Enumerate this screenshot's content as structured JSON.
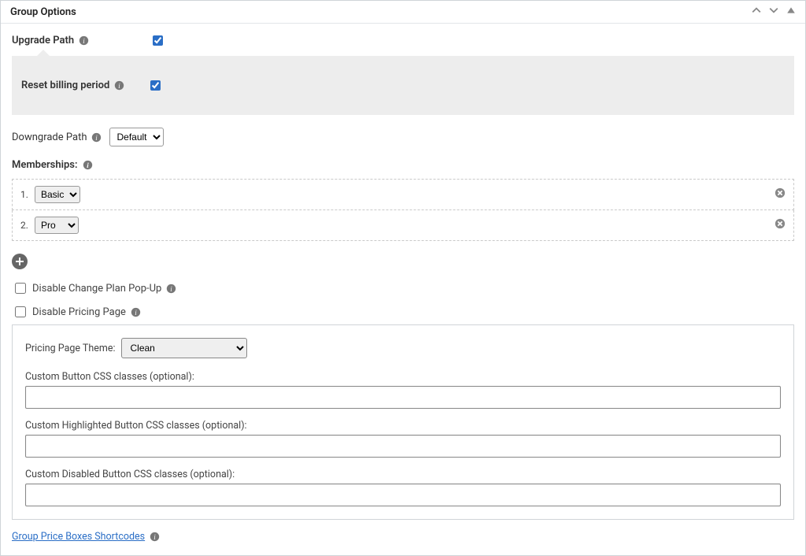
{
  "header": {
    "title": "Group Options"
  },
  "upgrade_path": {
    "label": "Upgrade Path",
    "checked": true
  },
  "reset_billing": {
    "label": "Reset billing period",
    "checked": true
  },
  "downgrade_path": {
    "label": "Downgrade Path",
    "value": "Default",
    "options": [
      "Default"
    ]
  },
  "memberships": {
    "label": "Memberships:",
    "items": [
      {
        "num": "1.",
        "value": "Basic",
        "options": [
          "Basic"
        ]
      },
      {
        "num": "2.",
        "value": "Pro",
        "options": [
          "Pro"
        ]
      }
    ]
  },
  "disable_change_plan": {
    "label": "Disable Change Plan Pop-Up",
    "checked": false
  },
  "disable_pricing_page": {
    "label": "Disable Pricing Page",
    "checked": false
  },
  "pricing_box": {
    "theme": {
      "label": "Pricing Page Theme:",
      "value": "Clean",
      "options": [
        "Clean"
      ]
    },
    "custom_button": {
      "label": "Custom Button CSS classes (optional):",
      "value": ""
    },
    "custom_highlighted": {
      "label": "Custom Highlighted Button CSS classes (optional):",
      "value": ""
    },
    "custom_disabled": {
      "label": "Custom Disabled Button CSS classes (optional):",
      "value": ""
    }
  },
  "shortcodes_link": {
    "label": "Group Price Boxes Shortcodes"
  }
}
